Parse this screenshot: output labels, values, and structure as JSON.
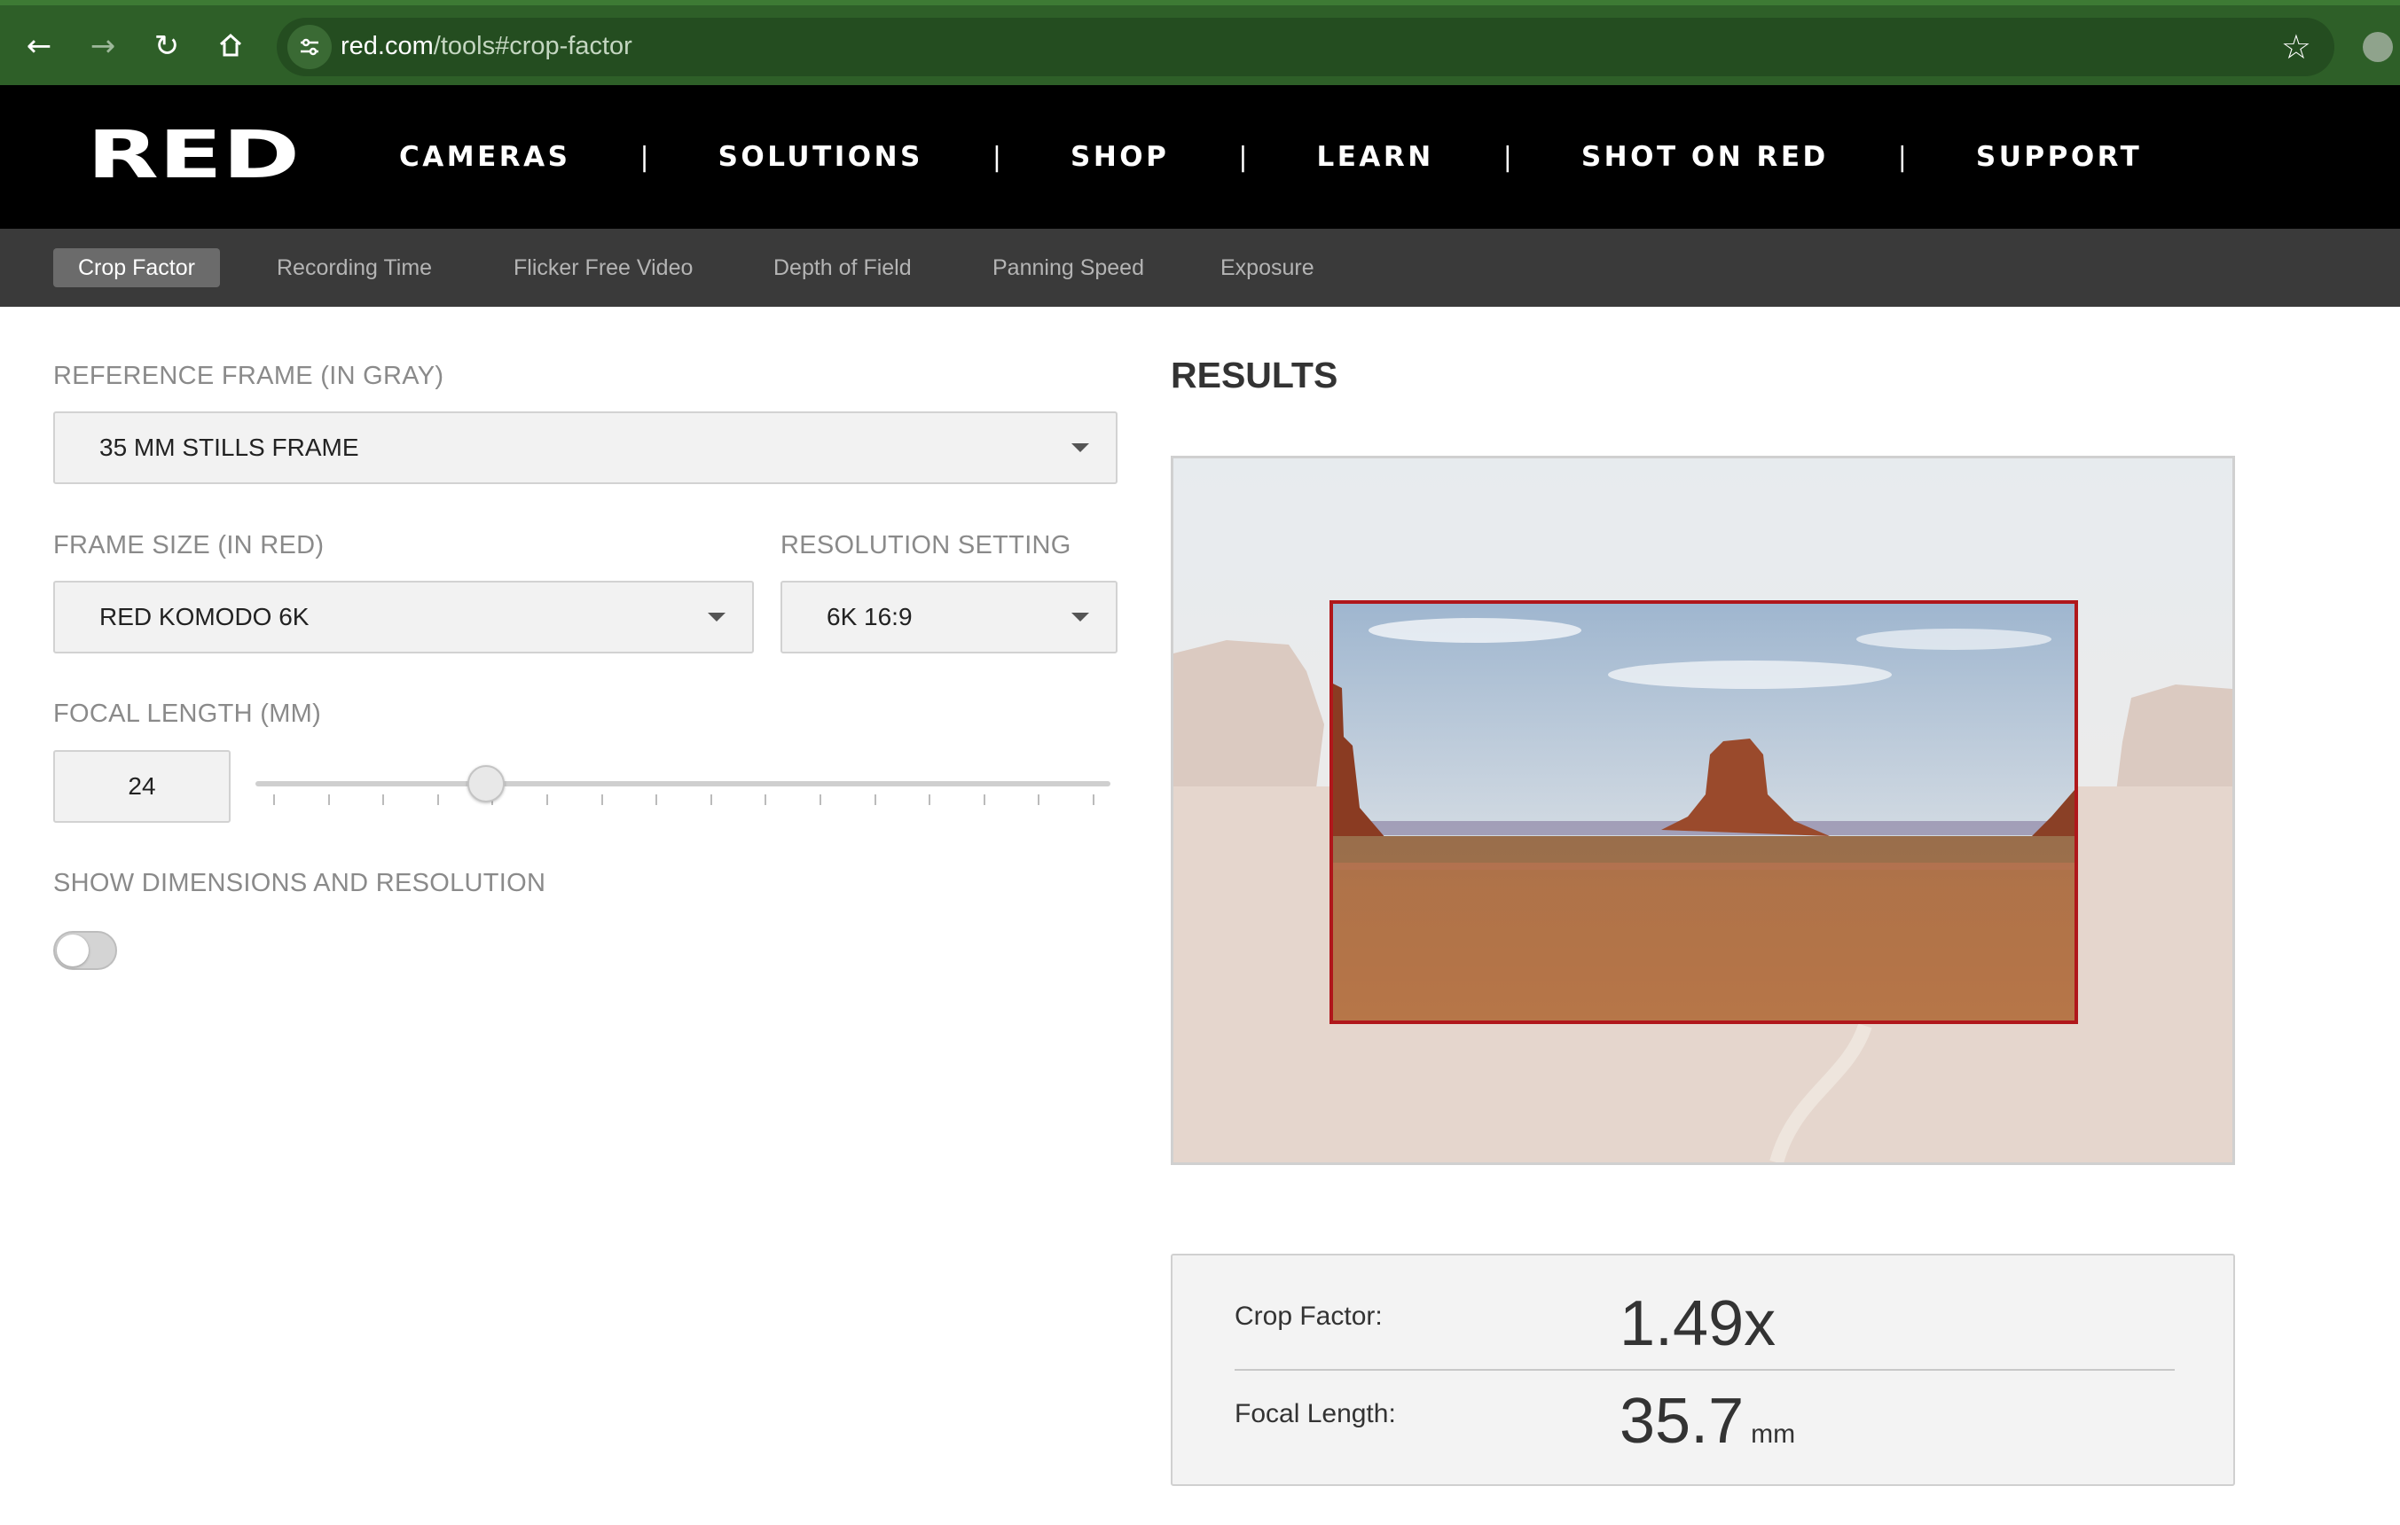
{
  "browser": {
    "url_domain": "red.com",
    "url_path": "/tools#crop-factor"
  },
  "site": {
    "logo_text": "RED",
    "nav": [
      "CAMERAS",
      "SOLUTIONS",
      "SHOP",
      "LEARN",
      "SHOT ON RED",
      "SUPPORT"
    ],
    "nav_separator": "|"
  },
  "subnav": {
    "items": [
      "Crop Factor",
      "Recording Time",
      "Flicker Free Video",
      "Depth of Field",
      "Panning Speed",
      "Exposure"
    ],
    "active": "Crop Factor"
  },
  "form": {
    "reference_frame_label": "REFERENCE FRAME (IN GRAY)",
    "reference_frame_value": "35 MM STILLS FRAME",
    "frame_size_label": "FRAME SIZE (IN RED)",
    "frame_size_value": "RED KOMODO 6K",
    "resolution_label": "RESOLUTION SETTING",
    "resolution_value": "6K 16:9",
    "focal_length_label": "FOCAL LENGTH (MM)",
    "focal_length_value": "24",
    "slider_position_fraction": 0.27,
    "show_dimensions_label": "SHOW DIMENSIONS AND RESOLUTION",
    "show_dimensions_on": false
  },
  "results": {
    "title": "RESULTS",
    "crop_factor_label": "Crop Factor:",
    "crop_factor_value": "1.49x",
    "focal_length_label": "Focal Length:",
    "focal_length_value": "35.7",
    "focal_length_unit": "mm"
  },
  "colors": {
    "accent_red": "#b0171b",
    "browser_green": "#2e5f28"
  }
}
